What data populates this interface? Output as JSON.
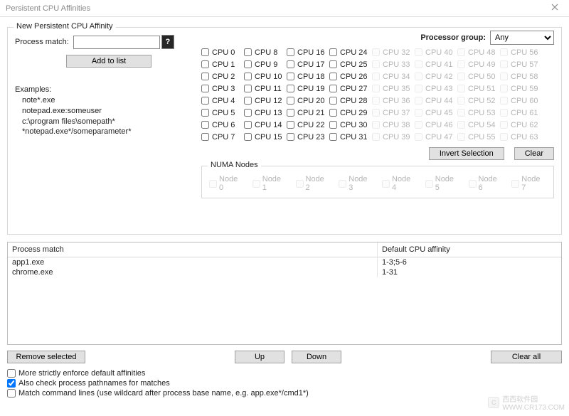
{
  "window": {
    "title": "Persistent CPU Affinities"
  },
  "group": {
    "legend": "New Persistent CPU Affinity",
    "process_match_label": "Process match:",
    "process_match_value": "",
    "help_glyph": "?",
    "add_btn": "Add to list",
    "examples_hdr": "Examples:",
    "examples": [
      "note*.exe",
      "notepad.exe:someuser",
      "c:\\program files\\somepath*",
      "*notepad.exe*/someparameter*"
    ],
    "proc_group_label": "Processor group:",
    "proc_group_value": "Any",
    "proc_group_options": [
      "Any"
    ],
    "cpu_prefix": "CPU ",
    "cpu_count": 64,
    "cpu_disabled_from": 32,
    "invert_btn": "Invert Selection",
    "clear_btn": "Clear",
    "numa": {
      "legend": "NUMA Nodes",
      "prefix": "Node ",
      "count": 8
    }
  },
  "table": {
    "headers": {
      "col1": "Process match",
      "col2": "Default CPU affinity"
    },
    "rows": [
      {
        "match": "app1.exe",
        "affinity": "1-3;5-6"
      },
      {
        "match": "chrome.exe",
        "affinity": "1-31"
      }
    ]
  },
  "bottom": {
    "remove_btn": "Remove selected",
    "up_btn": "Up",
    "down_btn": "Down",
    "clear_all_btn": "Clear all",
    "chk_strict": {
      "label": "More strictly enforce default affinities",
      "checked": false
    },
    "chk_path": {
      "label": "Also check process pathnames for matches",
      "checked": true
    },
    "chk_cmd": {
      "label": "Match command lines (use wildcard after process base name, e.g. app.exe*/cmd1*)",
      "checked": false
    }
  },
  "watermark": {
    "site": "西西软件园",
    "url": "WWW.CR173.COM",
    "icon_glyph": "C"
  }
}
